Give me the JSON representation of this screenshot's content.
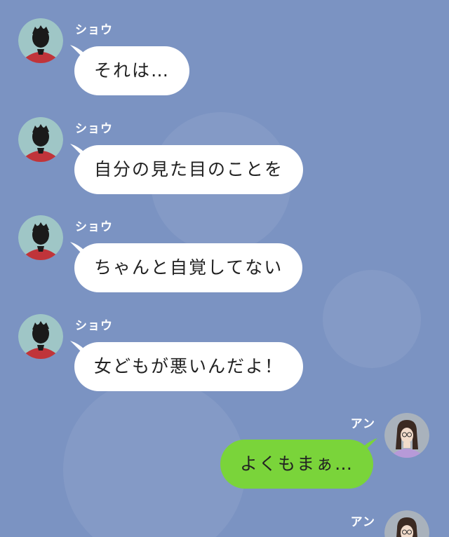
{
  "theme": {
    "background": "#7b93c2",
    "incoming_bubble": "#ffffff",
    "outgoing_bubble": "#7ad43a"
  },
  "messages": [
    {
      "sender": "ショウ",
      "direction": "incoming",
      "avatar": "man-avatar-icon",
      "text": "それは…"
    },
    {
      "sender": "ショウ",
      "direction": "incoming",
      "avatar": "man-avatar-icon",
      "text": "自分の見た目のことを"
    },
    {
      "sender": "ショウ",
      "direction": "incoming",
      "avatar": "man-avatar-icon",
      "text": "ちゃんと自覚してない"
    },
    {
      "sender": "ショウ",
      "direction": "incoming",
      "avatar": "man-avatar-icon",
      "text": "女どもが悪いんだよ！"
    },
    {
      "sender": "アン",
      "direction": "outgoing",
      "avatar": "woman-avatar-icon",
      "text": "よくもまぁ…"
    },
    {
      "sender": "アン",
      "direction": "outgoing",
      "avatar": "woman-avatar-icon",
      "text": ""
    }
  ]
}
